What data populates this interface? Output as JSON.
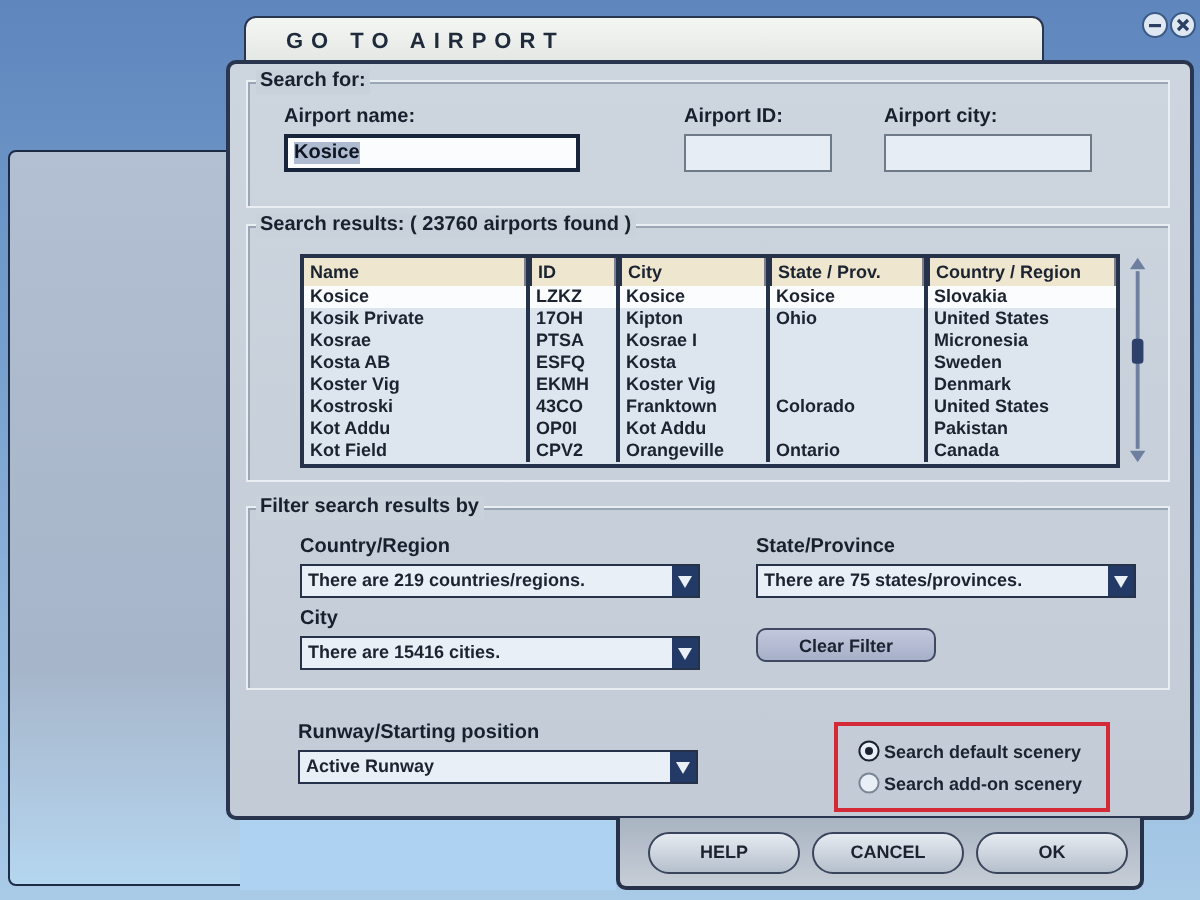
{
  "window": {
    "title": "GO TO AIRPORT"
  },
  "search_for": {
    "label": "Search for:",
    "fields": [
      {
        "label": "Airport name:",
        "value": "Kosice",
        "focused": true
      },
      {
        "label": "Airport ID:",
        "focused": false
      },
      {
        "label": "Airport city:",
        "focused": false
      }
    ]
  },
  "results": {
    "label": "Search results: ( 23760 airports found )",
    "columns": [
      "Name",
      "ID",
      "City",
      "State / Prov.",
      "Country / Region"
    ],
    "rows": [
      {
        "cells": [
          "Kosice",
          "LZKZ",
          "Kosice",
          "Kosice",
          "Slovakia"
        ],
        "selected": true
      },
      {
        "cells": [
          "Kosik Private",
          "17OH",
          "Kipton",
          "Ohio",
          "United States"
        ],
        "selected": false
      },
      {
        "cells": [
          "Kosrae",
          "PTSA",
          "Kosrae I",
          "",
          "Micronesia"
        ],
        "selected": false
      },
      {
        "cells": [
          "Kosta AB",
          "ESFQ",
          "Kosta",
          "",
          "Sweden"
        ],
        "selected": false
      },
      {
        "cells": [
          "Koster Vig",
          "EKMH",
          "Koster Vig",
          "",
          "Denmark"
        ],
        "selected": false
      },
      {
        "cells": [
          "Kostroski",
          "43CO",
          "Franktown",
          "Colorado",
          "United States"
        ],
        "selected": false
      },
      {
        "cells": [
          "Kot Addu",
          "OP0I",
          "Kot Addu",
          "",
          "Pakistan"
        ],
        "selected": false
      },
      {
        "cells": [
          "Kot Field",
          "CPV2",
          "Orangeville",
          "Ontario",
          "Canada"
        ],
        "selected": false
      }
    ]
  },
  "filter": {
    "label": "Filter search results by",
    "dropdowns": [
      {
        "label": "Country/Region",
        "value": "There are 219 countries/regions."
      },
      {
        "label": "State/Province",
        "value": "There are 75 states/provinces."
      },
      {
        "label": "City",
        "value": "There are 15416 cities."
      }
    ],
    "clear_button": "Clear Filter"
  },
  "runway": {
    "label": "Runway/Starting position",
    "value": "Active Runway"
  },
  "scenery_options": [
    {
      "label": "Search default scenery",
      "selected": true
    },
    {
      "label": "Search add-on scenery",
      "selected": false
    }
  ],
  "buttons": [
    "HELP",
    "CANCEL",
    "OK"
  ]
}
